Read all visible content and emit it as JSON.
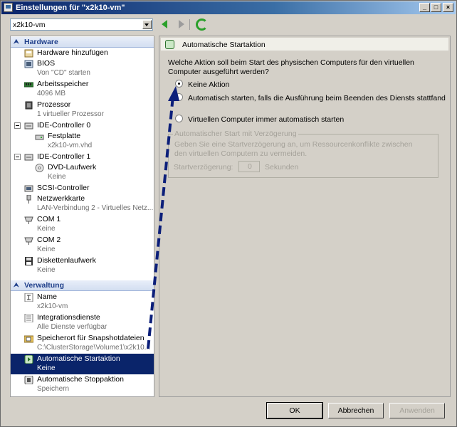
{
  "window": {
    "title": "Einstellungen für \"x2k10-vm\""
  },
  "vm_select": {
    "value": "x2k10-vm"
  },
  "sidebar": {
    "sections": [
      {
        "label": "Hardware"
      },
      {
        "label": "Verwaltung"
      }
    ],
    "hardware_items": [
      {
        "label": "Hardware hinzufügen",
        "sub": ""
      },
      {
        "label": "BIOS",
        "sub": "Von \"CD\" starten"
      },
      {
        "label": "Arbeitsspeicher",
        "sub": "4096 MB"
      },
      {
        "label": "Prozessor",
        "sub": "1 virtueller Prozessor"
      },
      {
        "label": "IDE-Controller 0",
        "sub": ""
      },
      {
        "label": "Festplatte",
        "sub": "x2k10-vm.vhd"
      },
      {
        "label": "IDE-Controller 1",
        "sub": ""
      },
      {
        "label": "DVD-Laufwerk",
        "sub": "Keine"
      },
      {
        "label": "SCSI-Controller",
        "sub": ""
      },
      {
        "label": "Netzwerkkarte",
        "sub": "LAN-Verbindung 2 - Virtuelles Netz..."
      },
      {
        "label": "COM 1",
        "sub": "Keine"
      },
      {
        "label": "COM 2",
        "sub": "Keine"
      },
      {
        "label": "Diskettenlaufwerk",
        "sub": "Keine"
      }
    ],
    "management_items": [
      {
        "label": "Name",
        "sub": "x2k10-vm"
      },
      {
        "label": "Integrationsdienste",
        "sub": "Alle Dienste verfügbar"
      },
      {
        "label": "Speicherort für Snapshotdateien",
        "sub": "C:\\ClusterStorage\\Volume1\\x2k10..."
      },
      {
        "label": "Automatische Startaktion",
        "sub": "Keine"
      },
      {
        "label": "Automatische Stoppaktion",
        "sub": "Speichern"
      }
    ]
  },
  "panel": {
    "title": "Automatische Startaktion",
    "question": "Welche Aktion soll beim Start des physischen Computers für den virtuellen Computer ausgeführt werden?",
    "options": [
      {
        "label": "Keine Aktion",
        "selected": true
      },
      {
        "label": "Automatisch starten, falls die Ausführung beim Beenden des Diensts stattfand",
        "selected": false
      },
      {
        "label": "Virtuellen Computer immer automatisch starten",
        "selected": false
      }
    ],
    "delay_group": {
      "label": "Automatischer Start mit Verzögerung",
      "description": "Geben Sie eine Startverzögerung an, um Ressourcenkonflikte zwischen den virtuellen Computern zu vermeiden.",
      "delay_label": "Startverzögerung:",
      "delay_value": "0",
      "delay_unit": "Sekunden"
    }
  },
  "buttons": {
    "ok": "OK",
    "cancel": "Abbrechen",
    "apply": "Anwenden"
  },
  "colors": {
    "selection": "#0a246a",
    "section_text": "#1f3f8a",
    "annotation_arrow": "#0c1f7a"
  }
}
